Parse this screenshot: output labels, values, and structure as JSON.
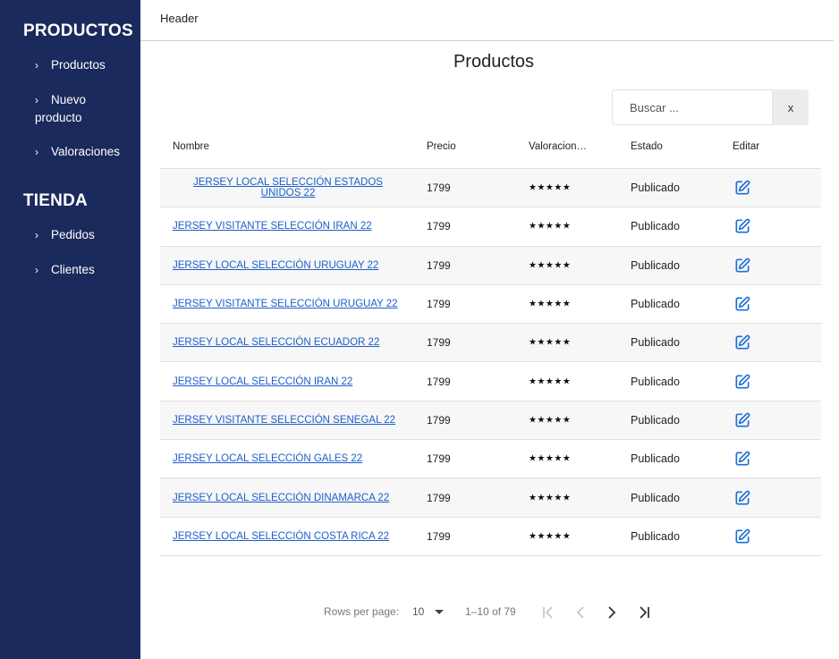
{
  "sidebar": {
    "sections": [
      {
        "title": "PRODUCTOS",
        "items": [
          {
            "label": "Productos"
          },
          {
            "label": "Nuevo producto"
          },
          {
            "label": "Valoraciones"
          }
        ]
      },
      {
        "title": "TIENDA",
        "items": [
          {
            "label": "Pedidos"
          },
          {
            "label": "Clientes"
          }
        ]
      }
    ]
  },
  "header": {
    "text": "Header"
  },
  "page": {
    "title": "Productos"
  },
  "search": {
    "placeholder": "Buscar ...",
    "value": "",
    "clear_label": "x"
  },
  "table": {
    "columns": [
      "Nombre",
      "Precio",
      "Valoracion…",
      "Estado",
      "Editar"
    ],
    "rows": [
      {
        "name": "JERSEY LOCAL SELECCIÓN ESTADOS UNIDOS 22",
        "price": "1799",
        "rating": "★★★★★",
        "status": "Publicado"
      },
      {
        "name": "JERSEY VISITANTE SELECCIÓN IRAN 22",
        "price": "1799",
        "rating": "★★★★★",
        "status": "Publicado"
      },
      {
        "name": "JERSEY LOCAL SELECCIÓN URUGUAY 22",
        "price": "1799",
        "rating": "★★★★★",
        "status": "Publicado"
      },
      {
        "name": "JERSEY VISITANTE SELECCIÓN URUGUAY 22",
        "price": "1799",
        "rating": "★★★★★",
        "status": "Publicado"
      },
      {
        "name": "JERSEY LOCAL SELECCIÓN ECUADOR 22",
        "price": "1799",
        "rating": "★★★★★",
        "status": "Publicado"
      },
      {
        "name": "JERSEY LOCAL SELECCIÓN IRAN 22",
        "price": "1799",
        "rating": "★★★★★",
        "status": "Publicado"
      },
      {
        "name": "JERSEY VISITANTE SELECCIÓN SENEGAL 22",
        "price": "1799",
        "rating": "★★★★★",
        "status": "Publicado"
      },
      {
        "name": "JERSEY LOCAL SELECCIÓN GALES 22",
        "price": "1799",
        "rating": "★★★★★",
        "status": "Publicado"
      },
      {
        "name": "JERSEY LOCAL SELECCIÓN DINAMARCA 22",
        "price": "1799",
        "rating": "★★★★★",
        "status": "Publicado"
      },
      {
        "name": "JERSEY LOCAL SELECCIÓN COSTA RICA 22",
        "price": "1799",
        "rating": "★★★★★",
        "status": "Publicado"
      }
    ],
    "edit_icon": "edit-icon"
  },
  "pagination": {
    "rows_per_page_label": "Rows per page:",
    "rows_per_page_value": "10",
    "range_text": "1–10 of 79"
  },
  "colors": {
    "sidebar_bg": "#1b2a5c",
    "link": "#1d5ec9",
    "edit_icon": "#1d6fd8"
  }
}
